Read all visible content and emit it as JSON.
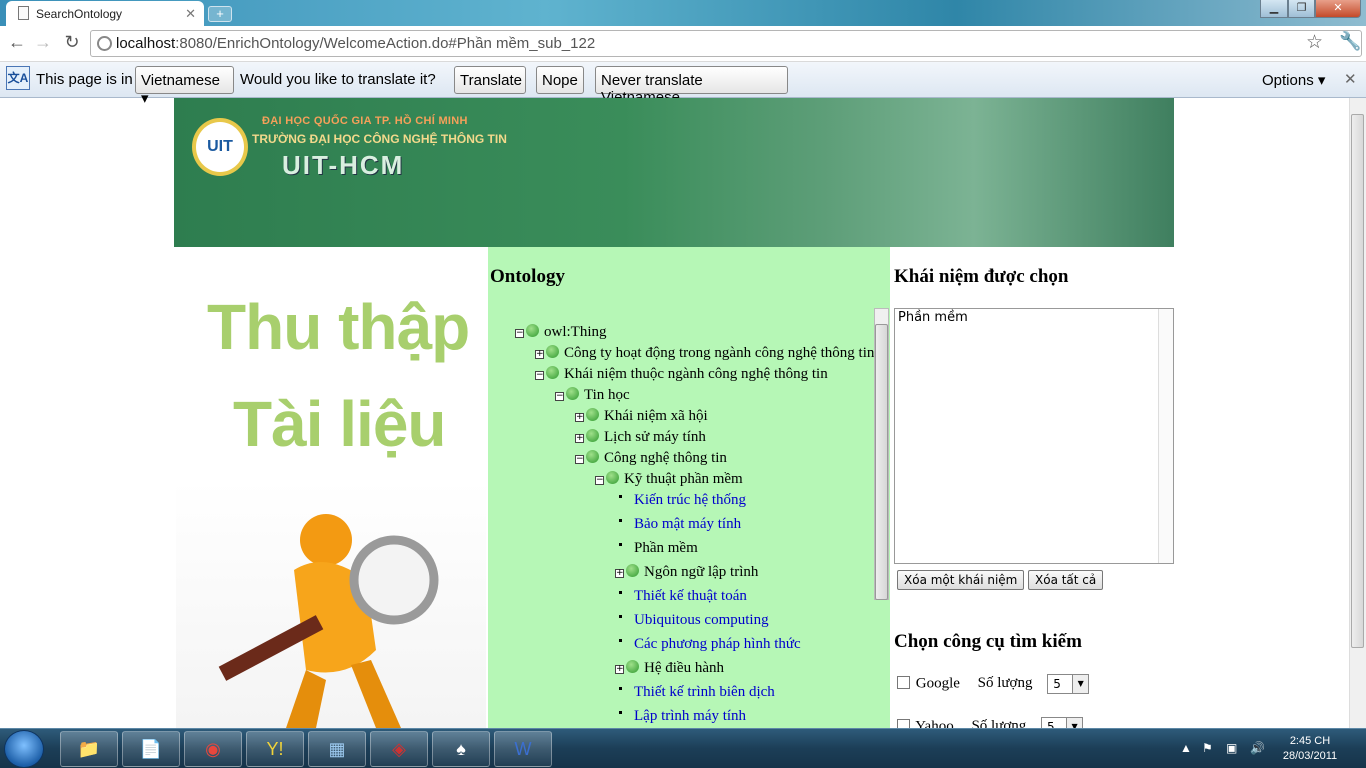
{
  "browser": {
    "tab_title": "SearchOntology",
    "url_host": "localhost",
    "url_path": ":8080/EnrichOntology/WelcomeAction.do#Phần mềm_sub_122"
  },
  "translate_bar": {
    "prefix": "This page is in",
    "language": "Vietnamese",
    "question": "Would you like to translate it?",
    "translate": "Translate",
    "nope": "Nope",
    "never": "Never translate Vietnamese",
    "options": "Options"
  },
  "banner": {
    "line1": "ĐẠI HỌC QUỐC GIA TP. HỒ CHÍ MINH",
    "line2": "TRƯỜNG ĐẠI HỌC CÔNG NGHỆ THÔNG TIN",
    "line3": "UIT-HCM",
    "logo": "UIT"
  },
  "side_image": {
    "line1": "Thu thập",
    "line2": "Tài liệu"
  },
  "ontology": {
    "title": "Ontology",
    "nodes": [
      {
        "label": "owl:Thing",
        "toggle": "⊟",
        "level": 0,
        "type": "folder"
      },
      {
        "label": "Công ty hoạt động trong ngành công nghệ thông tin",
        "toggle": "⊞",
        "level": 1,
        "type": "folder"
      },
      {
        "label": "Khái niệm thuộc ngành công nghệ thông tin",
        "toggle": "⊟",
        "level": 1,
        "type": "folder"
      },
      {
        "label": "Tin học",
        "toggle": "⊟",
        "level": 2,
        "type": "folder"
      },
      {
        "label": "Khái niệm xã hội",
        "toggle": "⊞",
        "level": 3,
        "type": "folder"
      },
      {
        "label": "Lịch sử máy tính",
        "toggle": "⊞",
        "level": 3,
        "type": "folder"
      },
      {
        "label": "Công nghệ thông tin",
        "toggle": "⊟",
        "level": 3,
        "type": "folder"
      },
      {
        "label": "Kỹ thuật phần mềm",
        "toggle": "⊟",
        "level": 4,
        "type": "folder"
      },
      {
        "label": "Kiến trúc hệ thống",
        "level": 5,
        "type": "link"
      },
      {
        "label": "Bảo mật máy tính",
        "level": 5,
        "type": "link"
      },
      {
        "label": "Phần mềm",
        "level": 5,
        "type": "selected"
      },
      {
        "label": "Ngôn ngữ lập trình",
        "toggle": "⊞",
        "level": 5,
        "type": "folder"
      },
      {
        "label": "Thiết kế thuật toán",
        "level": 5,
        "type": "link"
      },
      {
        "label": "Ubiquitous computing",
        "level": 5,
        "type": "link"
      },
      {
        "label": "Các phương pháp hình thức",
        "level": 5,
        "type": "link"
      },
      {
        "label": "Hệ điều hành",
        "toggle": "⊞",
        "level": 5,
        "type": "folder"
      },
      {
        "label": "Thiết kế trình biên dịch",
        "level": 5,
        "type": "link"
      },
      {
        "label": "Lập trình máy tính",
        "level": 5,
        "type": "link"
      }
    ]
  },
  "concepts": {
    "title": "Khái niệm được chọn",
    "value": "Phần mềm",
    "remove_one": "Xóa một khái niệm",
    "remove_all": "Xóa tất cả"
  },
  "search_tools": {
    "title": "Chọn công cụ tìm kiếm",
    "tools": [
      {
        "name": "Google",
        "count_label": "Số lượng",
        "count": "5"
      },
      {
        "name": "Yahoo",
        "count_label": "Số lượng",
        "count": "5"
      }
    ]
  },
  "taskbar": {
    "apps": [
      "explorer-icon",
      "notepad-icon",
      "chrome-icon",
      "yahoo-messenger-icon",
      "virtualbox-icon",
      "app-icon",
      "solitaire-icon",
      "word-icon"
    ],
    "time": "2:45 CH",
    "date": "28/03/2011"
  }
}
